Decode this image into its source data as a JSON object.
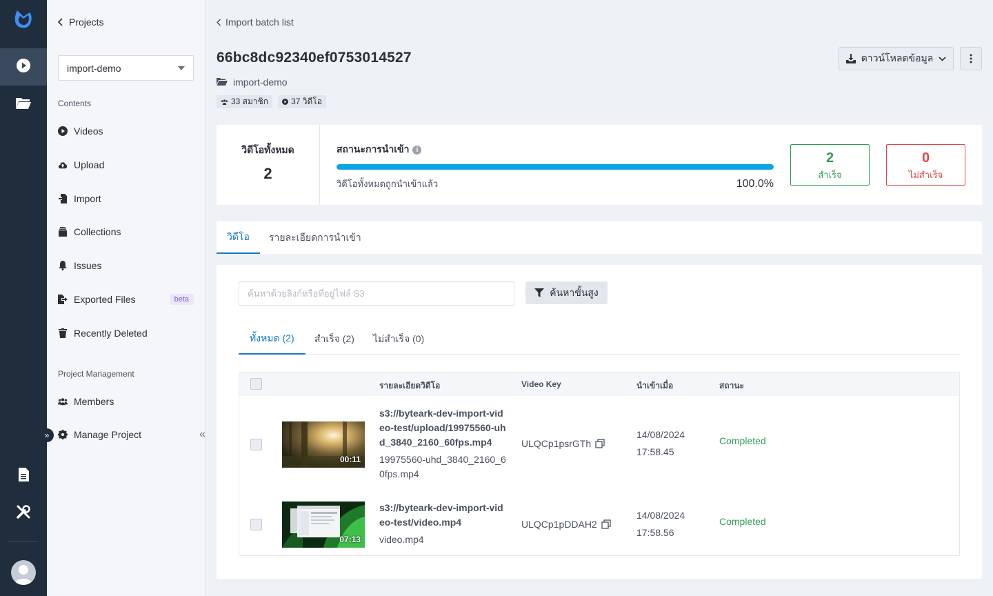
{
  "rail": {
    "icons": [
      "logo-icon",
      "play-icon",
      "folder-icon",
      "document-icon",
      "tools-icon",
      "avatar-icon"
    ]
  },
  "sidebar": {
    "back_label": "Projects",
    "project_select": "import-demo",
    "section_contents": "Contents",
    "items": [
      {
        "label": "Videos"
      },
      {
        "label": "Upload"
      },
      {
        "label": "Import"
      },
      {
        "label": "Collections"
      },
      {
        "label": "Issues"
      },
      {
        "label": "Exported Files",
        "badge": "beta"
      },
      {
        "label": "Recently Deleted"
      }
    ],
    "section_management": "Project Management",
    "mgmt_items": [
      {
        "label": "Members"
      },
      {
        "label": "Manage Project"
      }
    ]
  },
  "header": {
    "back_label": "Import batch list",
    "title": "66bc8dc92340ef0753014527",
    "project_name": "import-demo",
    "members_chip": "33 สมาชิก",
    "videos_chip": "37 วิดีโอ",
    "download_label": "ดาวน์โหลดข้อมูล"
  },
  "stats": {
    "total_label": "วิดีโอทั้งหมด",
    "total_value": "2",
    "status_label": "สถานะการนำเข้า",
    "progress_fraction": 1.0,
    "progress_sub": "วิดีโอทั้งหมดถูกนำเข้าแล้ว",
    "progress_pct": "100.0%",
    "success_value": "2",
    "success_label": "สำเร็จ",
    "fail_value": "0",
    "fail_label": "ไม่สำเร็จ"
  },
  "tabs": {
    "videos": "วิดีโอ",
    "details": "รายละเอียดการนำเข้า"
  },
  "filter": {
    "search_placeholder": "ค้นหาด้วยลิงก์หรือที่อยู่ไฟล์ S3",
    "advanced_label": "ค้นหาขั้นสูง",
    "subtab_all": "ทั้งหมด (2)",
    "subtab_success": "สำเร็จ (2)",
    "subtab_fail": "ไม่สำเร็จ (0)"
  },
  "table": {
    "headers": {
      "details": "รายละเอียดวิดีโอ",
      "key": "Video Key",
      "imported": "นำเข้าเมื่อ",
      "status": "สถานะ"
    },
    "rows": [
      {
        "duration": "00:11",
        "path": "s3://byteark-dev-import-video-test/upload/19975560-uhd_3840_2160_60fps.mp4",
        "filename": "19975560-uhd_3840_2160_60fps.mp4",
        "video_key": "ULQCp1psrGTh",
        "date": "14/08/2024",
        "time": "17:58.45",
        "status": "Completed"
      },
      {
        "duration": "07:13",
        "path": "s3://byteark-dev-import-video-test/video.mp4",
        "filename": "video.mp4",
        "video_key": "ULQCp1pDDAH2",
        "date": "14/08/2024",
        "time": "17:58.56",
        "status": "Completed"
      }
    ]
  },
  "colors": {
    "accent": "#1677c8",
    "success": "#2f9e55",
    "danger": "#e04848",
    "rail": "#1f2d3d",
    "progress": "#0aa5e8"
  }
}
